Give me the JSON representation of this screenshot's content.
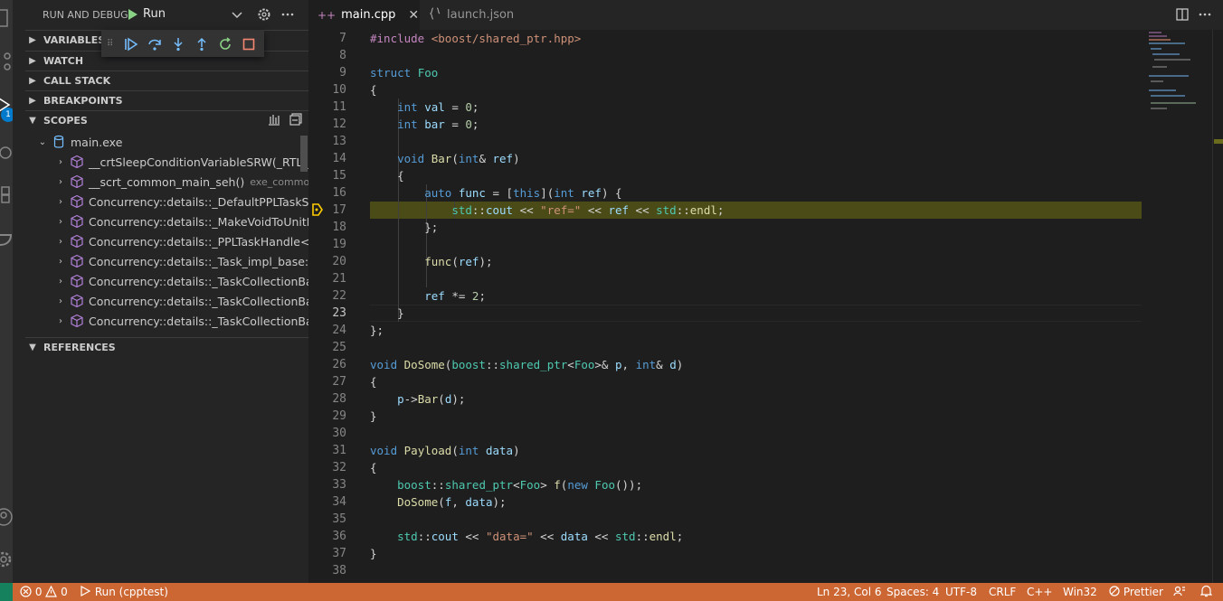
{
  "sidebar": {
    "title": "RUN AND DEBUG",
    "run_config": "Run",
    "sections": {
      "variables": "VARIABLES",
      "watch": "WATCH",
      "call_stack": "CALL STACK",
      "breakpoints": "BREAKPOINTS",
      "scopes": "SCOPES",
      "references": "REFERENCES"
    },
    "tree": [
      {
        "name": "main.exe",
        "desc": ""
      },
      {
        "name": "__crtSleepConditionVariableSRW(_RTL_...",
        "desc": ""
      },
      {
        "name": "__scrt_common_main_seh()",
        "desc": "exe_common..."
      },
      {
        "name": "Concurrency::details::_DefaultPPLTaskSc...",
        "desc": ""
      },
      {
        "name": "Concurrency::details::_MakeVoidToUnitF...",
        "desc": ""
      },
      {
        "name": "Concurrency::details::_PPLTaskHandle<u...",
        "desc": ""
      },
      {
        "name": "Concurrency::details::_Task_impl_base::_...",
        "desc": ""
      },
      {
        "name": "Concurrency::details::_TaskCollectionBas...",
        "desc": ""
      },
      {
        "name": "Concurrency::details::_TaskCollectionBas...",
        "desc": ""
      },
      {
        "name": "Concurrency::details::_TaskCollectionBas...",
        "desc": ""
      }
    ],
    "badge": "1"
  },
  "tabs": [
    {
      "label": "main.cpp",
      "active": true
    },
    {
      "label": "launch.json",
      "active": false
    }
  ],
  "editor": {
    "line_numbers": [
      "7",
      "8",
      "9",
      "10",
      "11",
      "12",
      "13",
      "14",
      "15",
      "16",
      "17",
      "18",
      "19",
      "20",
      "21",
      "22",
      "23",
      "24",
      "25",
      "26",
      "27",
      "28",
      "29",
      "30",
      "31",
      "32",
      "33",
      "34",
      "35",
      "36",
      "37",
      "38"
    ],
    "current_line": "23",
    "paused_line": "17"
  },
  "status": {
    "errors": "0",
    "warnings": "0",
    "debug": "Run (cpptest)",
    "position": "Ln 23, Col 6",
    "spaces": "Spaces: 4",
    "encoding": "UTF-8",
    "eol": "CRLF",
    "language": "C++",
    "config": "Win32",
    "prettier": "Prettier"
  },
  "colors": {
    "statusbar": "#cc6633",
    "highlight_line": "#4b4b18",
    "sidebar": "#252526",
    "editor": "#1e1e1e"
  },
  "icons": [
    "files-icon",
    "source-control-icon",
    "run-debug-icon",
    "remote-icon",
    "extensions-icon",
    "docker-icon",
    "account-icon",
    "settings-gear-icon",
    "gear-icon",
    "more-icon",
    "continue-icon",
    "step-over-icon",
    "step-into-icon",
    "step-out-icon",
    "restart-icon",
    "stop-icon",
    "split-editor-icon",
    "error-icon",
    "warning-icon",
    "bell-icon"
  ]
}
